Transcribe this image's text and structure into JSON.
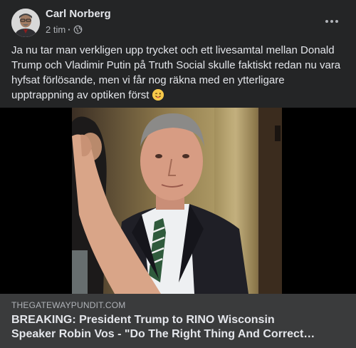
{
  "post": {
    "author": "Carl Norberg",
    "time": "2 tim",
    "separator": "·",
    "privacy_icon": "globe-icon",
    "text": "Ja nu tar man verkligen upp trycket och ett livesamtal mellan Donald Trump och Vladimir Putin på Truth Social skulle faktiskt redan nu vara hyfsat förlösande, men vi får nog räkna med en ytterligare upptrappning av optiken först",
    "emoji": "winking-face-emoji"
  },
  "link": {
    "domain": "THEGATEWAYPUNDIT.COM",
    "title_line1": "BREAKING: President Trump to RINO Wisconsin",
    "title_line2": "Speaker Robin Vos - \"Do The Right Thing And Correct…"
  },
  "colors": {
    "background": "#242526",
    "link_box": "#3a3b3c",
    "primary_text": "#e4e6eb",
    "secondary_text": "#b0b3b8"
  }
}
